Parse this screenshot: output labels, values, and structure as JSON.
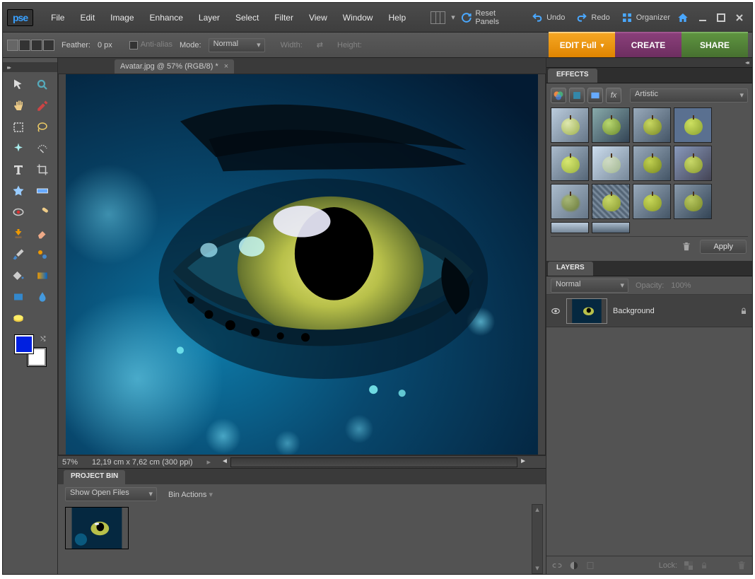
{
  "app": {
    "logo": "pse"
  },
  "menu": {
    "file": "File",
    "edit": "Edit",
    "image": "Image",
    "enhance": "Enhance",
    "layer": "Layer",
    "select": "Select",
    "filter": "Filter",
    "view": "View",
    "window": "Window",
    "help": "Help"
  },
  "top": {
    "reset": "Reset Panels",
    "undo": "Undo",
    "redo": "Redo",
    "organizer": "Organizer"
  },
  "options": {
    "feather_label": "Feather:",
    "feather_value": "0 px",
    "antialias": "Anti-alias",
    "mode_label": "Mode:",
    "mode_value": "Normal",
    "width": "Width:",
    "height": "Height:"
  },
  "tabs": {
    "edit": "EDIT Full",
    "create": "CREATE",
    "share": "SHARE"
  },
  "document": {
    "tab_title": "Avatar.jpg @ 57% (RGB/8) *",
    "zoom": "57%",
    "dims": "12,19 cm x 7,62 cm (300 ppi)"
  },
  "bin": {
    "title": "PROJECT BIN",
    "show": "Show Open Files",
    "actions": "Bin Actions"
  },
  "effects": {
    "title": "EFFECTS",
    "category": "Artistic",
    "apply": "Apply"
  },
  "layers": {
    "title": "LAYERS",
    "blend": "Normal",
    "opacity_label": "Opacity:",
    "opacity": "100%",
    "item": "Background",
    "lock_label": "Lock:"
  },
  "colors": {
    "fg": "#0020e0",
    "bg": "#ffffff"
  }
}
